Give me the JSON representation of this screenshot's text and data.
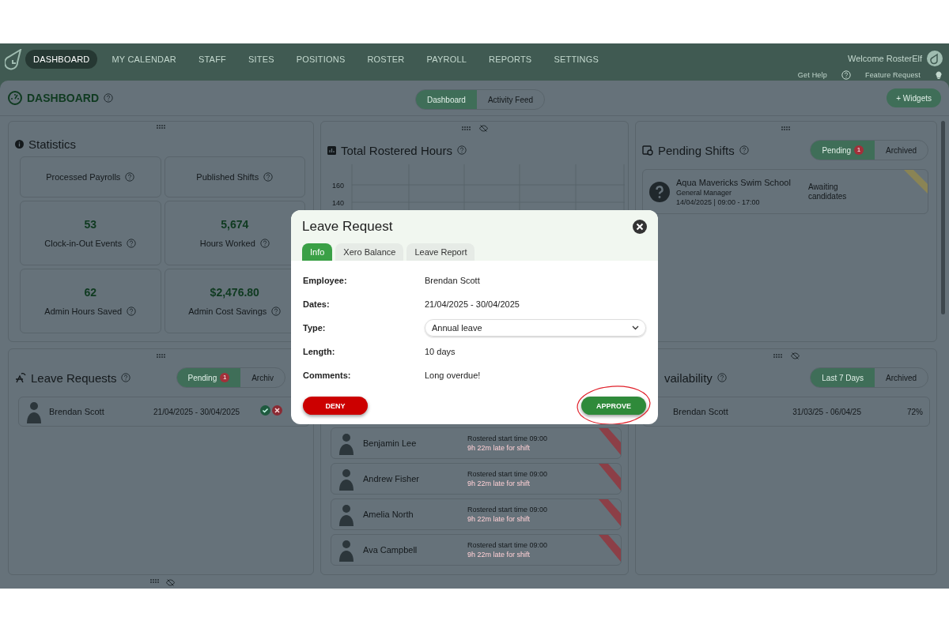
{
  "nav": {
    "items": [
      {
        "label": "DASHBOARD",
        "selected": true
      },
      {
        "label": "MY CALENDAR",
        "selected": false
      },
      {
        "label": "STAFF",
        "selected": false
      },
      {
        "label": "SITES",
        "selected": false
      },
      {
        "label": "POSITIONS",
        "selected": false
      },
      {
        "label": "ROSTER",
        "selected": false
      },
      {
        "label": "PAYROLL",
        "selected": false
      },
      {
        "label": "REPORTS",
        "selected": false
      },
      {
        "label": "SETTINGS",
        "selected": false
      }
    ],
    "welcome": "Welcome RosterElf",
    "help_link": "Get Help",
    "feature_link": "Feature Request"
  },
  "header": {
    "title": "DASHBOARD",
    "views": [
      {
        "label": "Dashboard",
        "selected": true
      },
      {
        "label": "Activity Feed",
        "selected": false
      }
    ],
    "add_button": "+ Widgets"
  },
  "statistics": {
    "title": "Statistics",
    "tiles": [
      {
        "label": "Processed Payrolls"
      },
      {
        "label": "Published Shifts"
      },
      {
        "value": "53",
        "label": "Clock-in-Out Events"
      },
      {
        "value": "5,674",
        "label": "Hours Worked"
      },
      {
        "value": "62",
        "label": "Admin Hours Saved"
      },
      {
        "value": "$2,476.80",
        "label": "Admin Cost Savings"
      }
    ]
  },
  "rostered_hours": {
    "title": "Total Rostered Hours",
    "y_tick_labels": [
      "160",
      "140"
    ]
  },
  "pending_shifts": {
    "title": "Pending Shifts",
    "tabs": [
      {
        "label": "Pending",
        "badge": "1",
        "selected": true
      },
      {
        "label": "Archived",
        "selected": false
      }
    ],
    "shifts": [
      {
        "site": "Aqua Mavericks Swim School",
        "position": "General Manager",
        "time": "14/04/2025 | 09:00 - 17:00",
        "status": "Awaiting candidates"
      }
    ]
  },
  "leave_requests": {
    "title": "Leave Requests",
    "tabs": [
      {
        "label": "Pending",
        "badge": "1",
        "selected": true
      },
      {
        "label": "Archiv",
        "selected": false
      }
    ],
    "requests": [
      {
        "name": "Brendan Scott",
        "dates": "21/04/2025 - 30/04/2025"
      }
    ]
  },
  "late_staff": {
    "rows": [
      {
        "name": "Benjamin Lee",
        "rostered": "Rostered start time 09:00",
        "late": "9h 22m late for shift"
      },
      {
        "name": "Andrew Fisher",
        "rostered": "Rostered start time 09:00",
        "late": "9h 22m late for shift"
      },
      {
        "name": "Amelia North",
        "rostered": "Rostered start time 09:00",
        "late": "9h 22m late for shift"
      },
      {
        "name": "Ava Campbell",
        "rostered": "Rostered start time 09:00",
        "late": "9h 22m late for shift"
      }
    ]
  },
  "availability": {
    "title": "vailability",
    "tabs": [
      {
        "label": "Last 7 Days",
        "selected": true
      },
      {
        "label": "Archived",
        "selected": false
      }
    ],
    "rows": [
      {
        "name": "Brendan Scott",
        "period": "31/03/25 - 06/04/25",
        "percent": "72%"
      }
    ]
  },
  "modal": {
    "title": "Leave Request",
    "tabs": [
      {
        "label": "Info",
        "selected": true
      },
      {
        "label": "Xero Balance",
        "selected": false
      },
      {
        "label": "Leave Report",
        "selected": false
      }
    ],
    "fields": [
      {
        "kind": "text",
        "label": "Employee:",
        "value": "Brendan Scott"
      },
      {
        "kind": "text",
        "label": "Dates:",
        "value": "21/04/2025 - 30/04/2025"
      },
      {
        "kind": "select",
        "label": "Type:",
        "value": "Annual leave"
      },
      {
        "kind": "text",
        "label": "Length:",
        "value": "10 days"
      },
      {
        "kind": "text",
        "label": "Comments:",
        "value": "Long overdue!"
      }
    ],
    "buttons": [
      {
        "kind": "deny",
        "label": "DENY",
        "highlighted": false
      },
      {
        "kind": "approve",
        "label": "APPROVE",
        "highlighted": true
      }
    ]
  }
}
